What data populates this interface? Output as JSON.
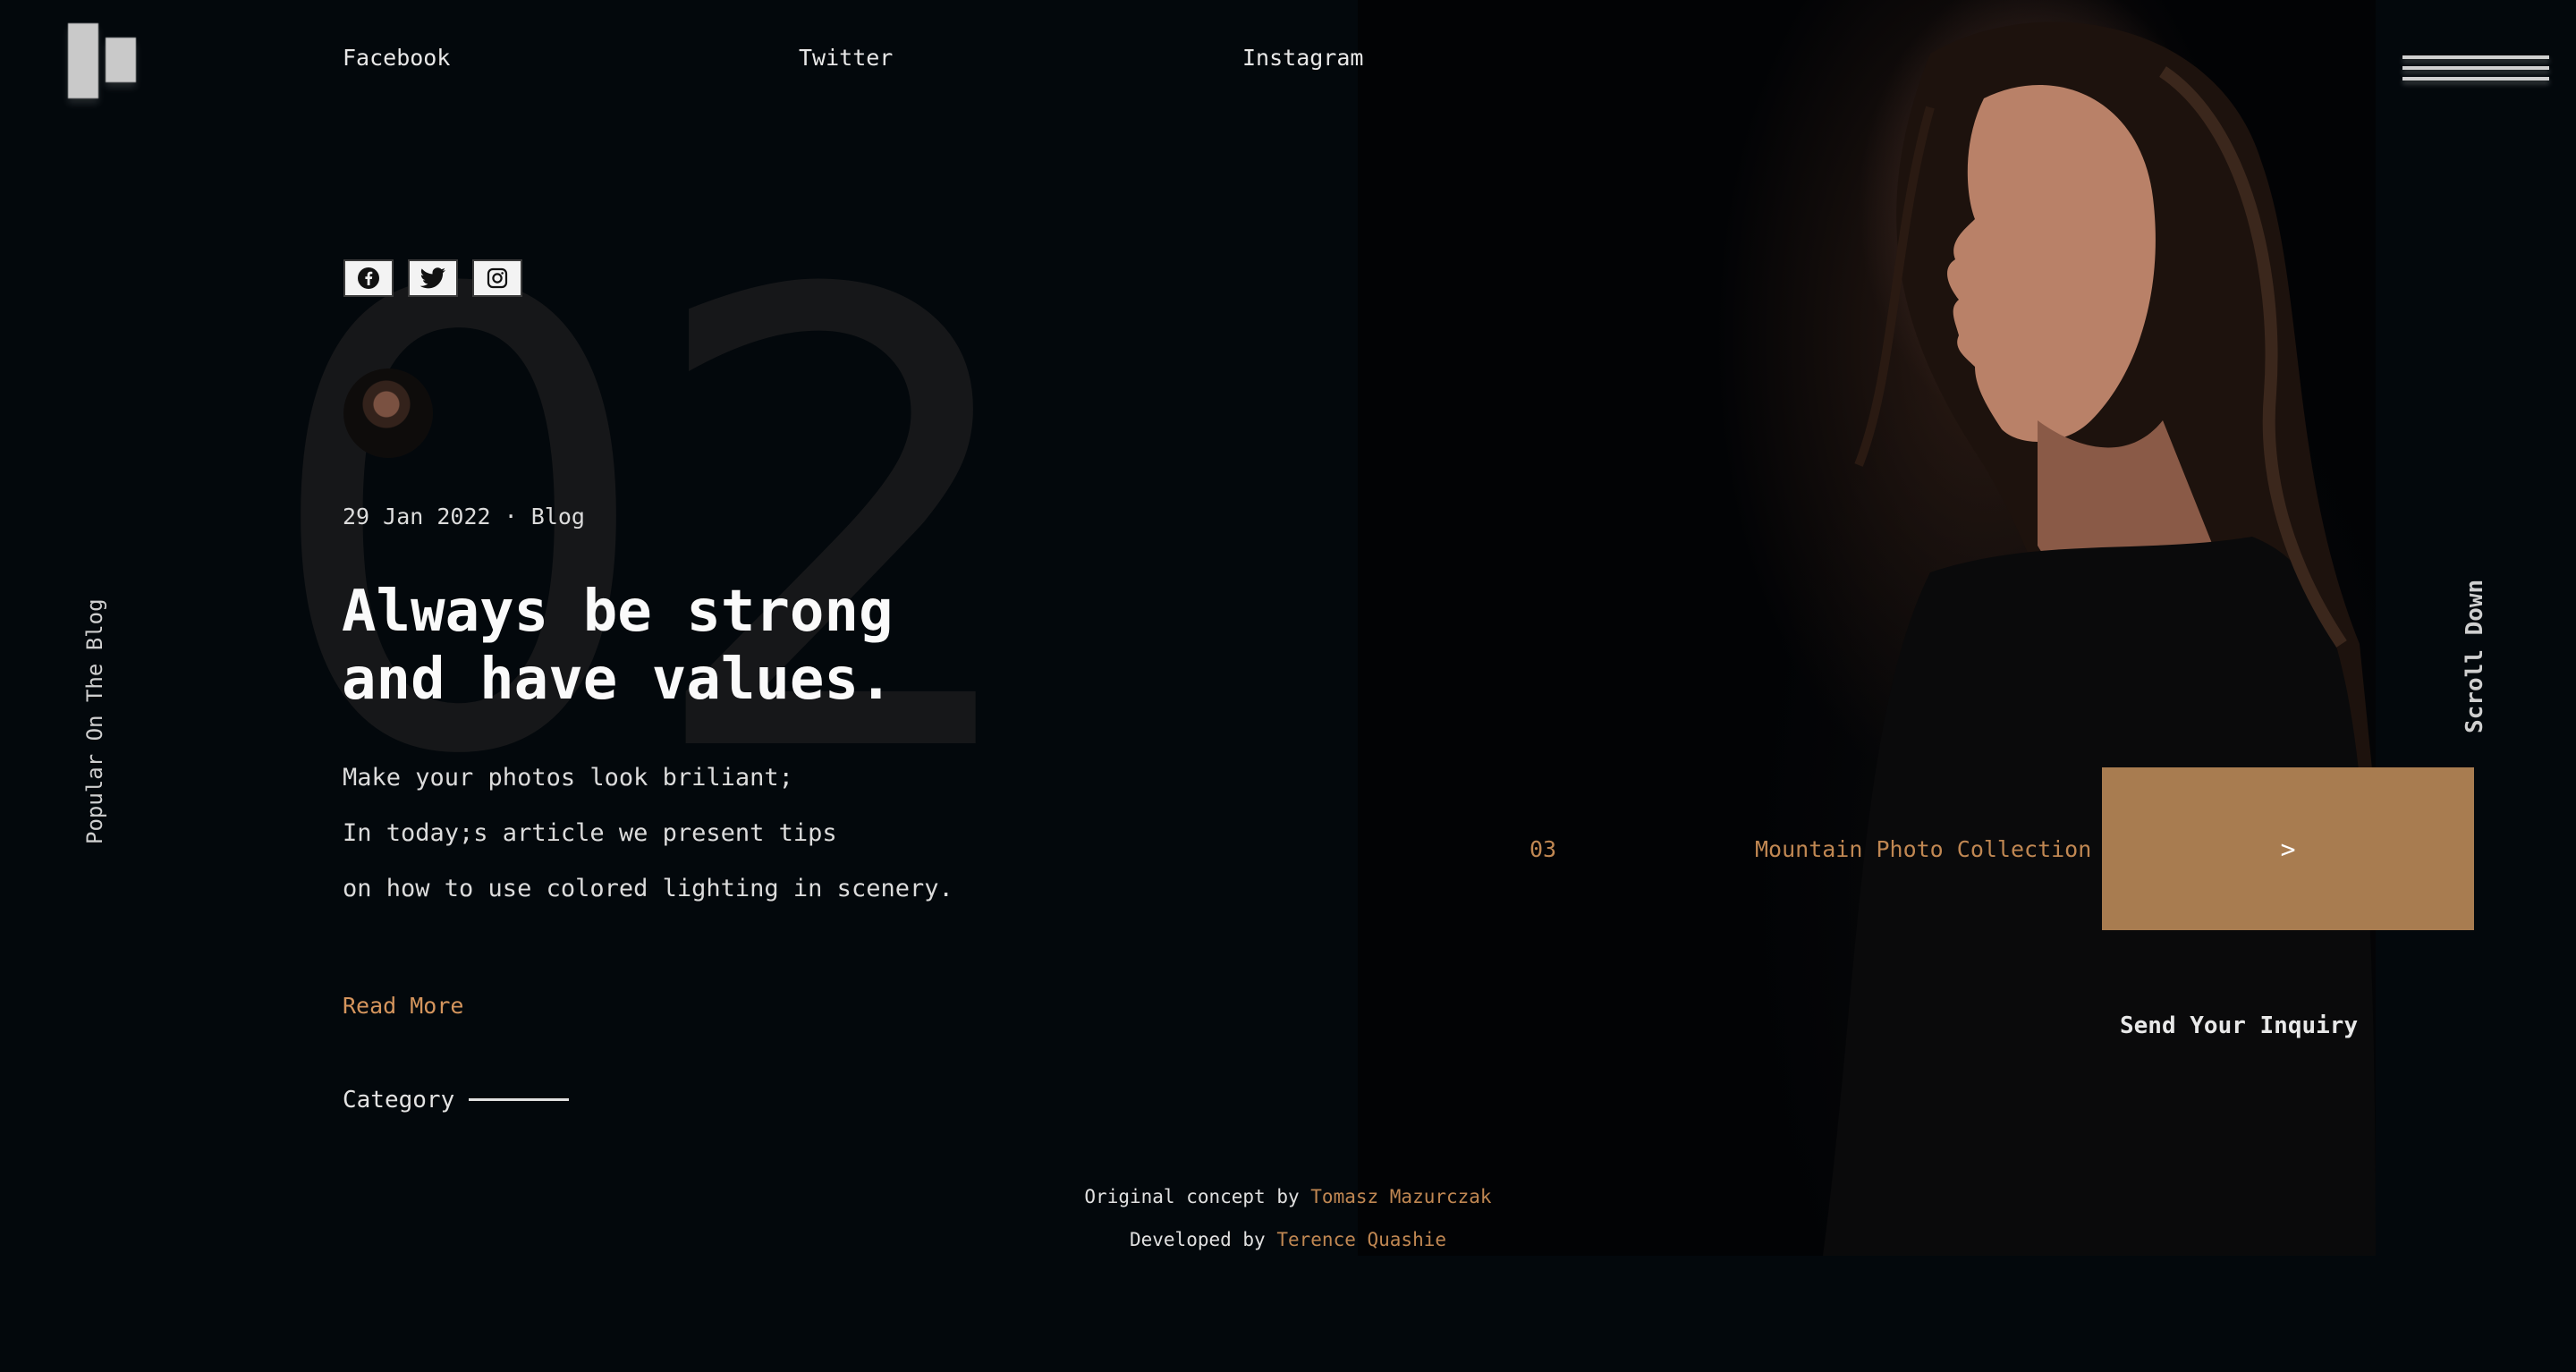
{
  "nav": {
    "links": [
      "Facebook",
      "Twitter",
      "Instagram"
    ]
  },
  "icons": {
    "logo": "brand-logo",
    "menu": "hamburger-icon",
    "social": [
      "facebook-icon",
      "twitter-icon",
      "instagram-icon"
    ]
  },
  "hero": {
    "number": "02"
  },
  "post": {
    "date": "29 Jan 2022",
    "separator": "·",
    "category_tag": "Blog",
    "title": "Always be strong and have values.",
    "lines": [
      "Make your photos look briliant;",
      "In today;s article we present tips",
      "on how to use colored lighting in scenery."
    ],
    "read_more": "Read More",
    "category_label": "Category"
  },
  "side": {
    "left": "Popular On The Blog",
    "right": "Scroll Down"
  },
  "slider": {
    "number": "03",
    "title": "Mountain Photo Collection",
    "next_symbol": ">"
  },
  "inquiry": "Send Your Inquiry",
  "footer": {
    "concept_prefix": "Original concept by",
    "concept_author": "Tomasz Mazurczak",
    "dev_prefix": "Developed by",
    "dev_author": "Terence Quashie"
  },
  "colors": {
    "background": "#03080c",
    "accent": "#c08752",
    "slider_button": "#a87c50"
  }
}
